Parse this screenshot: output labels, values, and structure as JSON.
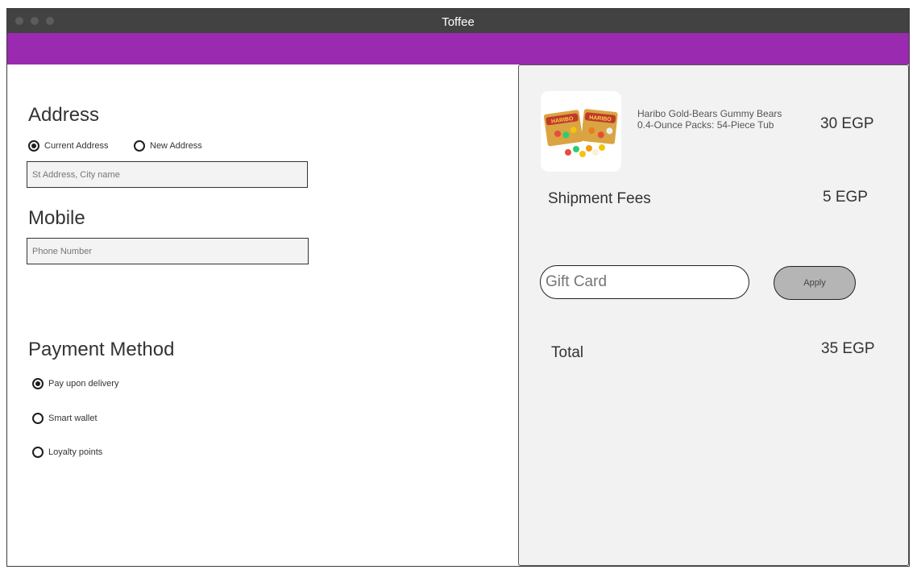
{
  "window": {
    "title": "Toffee"
  },
  "address": {
    "title": "Address",
    "options": [
      {
        "label": "Current Address",
        "selected": true
      },
      {
        "label": "New Address",
        "selected": false
      }
    ],
    "field_placeholder": "St Address, City name"
  },
  "mobile": {
    "title": "Mobile",
    "field_placeholder": "Phone Number"
  },
  "payment": {
    "title": "Payment Method",
    "options": [
      {
        "label": "Pay upon delivery",
        "selected": true
      },
      {
        "label": "Smart wallet",
        "selected": false
      },
      {
        "label": "Loyalty points",
        "selected": false
      }
    ]
  },
  "summary": {
    "product": {
      "name": "Haribo Gold-Bears Gummy Bears 0.4-Ounce Packs: 54-Piece Tub",
      "price": "30 EGP",
      "image_icon": "gummy-bears-product-image"
    },
    "shipment": {
      "label": "Shipment Fees",
      "value": "5 EGP"
    },
    "gift_card": {
      "placeholder": "Gift Card",
      "apply_label": "Apply"
    },
    "total": {
      "label": "Total",
      "value": "35 EGP"
    }
  },
  "colors": {
    "titlebar": "#424242",
    "accent_bar": "#9a2ab0",
    "panel_bg": "#f2f2f2",
    "apply_button": "#b5b5b5"
  }
}
